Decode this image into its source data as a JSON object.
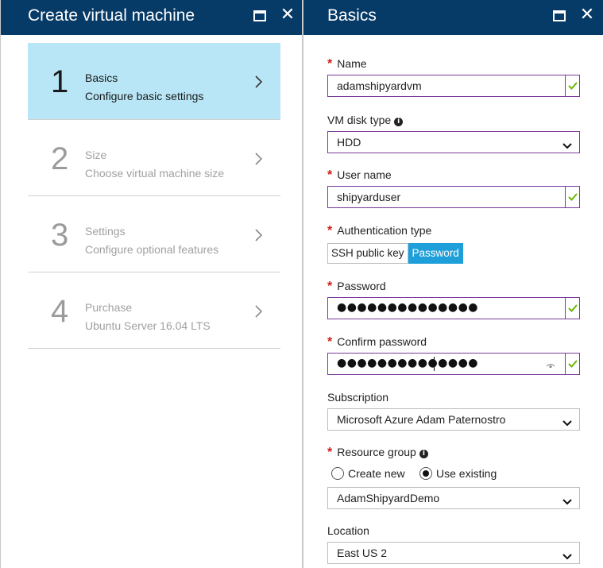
{
  "left_blade": {
    "title": "Create virtual machine",
    "steps": [
      {
        "number": "1",
        "title": "Basics",
        "subtitle": "Configure basic settings",
        "active": true
      },
      {
        "number": "2",
        "title": "Size",
        "subtitle": "Choose virtual machine size",
        "active": false
      },
      {
        "number": "3",
        "title": "Settings",
        "subtitle": "Configure optional features",
        "active": false
      },
      {
        "number": "4",
        "title": "Purchase",
        "subtitle": "Ubuntu Server 16.04 LTS",
        "active": false
      }
    ]
  },
  "right_blade": {
    "title": "Basics",
    "name": {
      "label": "Name",
      "required": "*",
      "value": "adamshipyardvm"
    },
    "disk_type": {
      "label": "VM disk type",
      "value": "HDD"
    },
    "user_name": {
      "label": "User name",
      "required": "*",
      "value": "shipyarduser"
    },
    "auth_type": {
      "label": "Authentication type",
      "required": "*",
      "options": [
        "SSH public key",
        "Password"
      ],
      "selected": "Password"
    },
    "password": {
      "label": "Password",
      "required": "*",
      "value": "●●●●●●●●●●●●●●"
    },
    "confirm_password": {
      "label": "Confirm password",
      "required": "*",
      "value": "●●●●●●●●●●●●●●"
    },
    "subscription": {
      "label": "Subscription",
      "value": "Microsoft Azure Adam Paternostro"
    },
    "resource_group": {
      "label": "Resource group",
      "required": "*",
      "radio_create": "Create new",
      "radio_existing": "Use existing",
      "selected": "Use existing",
      "value": "AdamShipyardDemo"
    },
    "location": {
      "label": "Location",
      "value": "East US 2"
    }
  },
  "colors": {
    "header_bg": "#063a67",
    "active_step_bg": "#b8e6f6",
    "field_border_valid": "#7a3a9b",
    "check_green": "#6bb700",
    "required_red": "#d01a1a",
    "toggle_selected": "#1e9fd9"
  },
  "icons": {
    "maximize": "maximize-icon",
    "close": "close-icon",
    "step_chevron": "chevron-right-icon",
    "valid": "check-icon",
    "dropdown": "chevron-down-icon",
    "info": "info-icon",
    "reveal_password": "eye-icon"
  }
}
